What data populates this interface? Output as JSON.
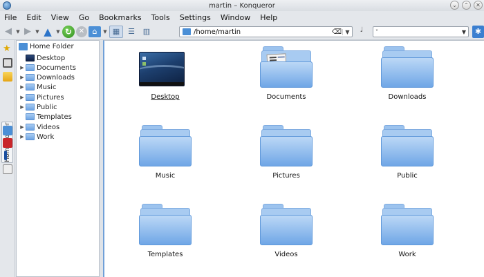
{
  "window": {
    "title": "martin – Konqueror"
  },
  "menu": [
    "File",
    "Edit",
    "View",
    "Go",
    "Bookmarks",
    "Tools",
    "Settings",
    "Window",
    "Help"
  ],
  "toolbar": {
    "location": "/home/martin",
    "search_value": ""
  },
  "sidebar_tab": "Home Folder",
  "tree": {
    "root": "Home Folder",
    "items": [
      "Desktop",
      "Documents",
      "Downloads",
      "Music",
      "Pictures",
      "Public",
      "Templates",
      "Videos",
      "Work"
    ]
  },
  "files": [
    {
      "name": "Desktop",
      "icon": "desktop-thumbnail"
    },
    {
      "name": "Documents",
      "icon": "folder-documents"
    },
    {
      "name": "Downloads",
      "icon": "folder"
    },
    {
      "name": "Music",
      "icon": "folder"
    },
    {
      "name": "Pictures",
      "icon": "folder"
    },
    {
      "name": "Public",
      "icon": "folder"
    },
    {
      "name": "Templates",
      "icon": "folder"
    },
    {
      "name": "Videos",
      "icon": "folder"
    },
    {
      "name": "Work",
      "icon": "folder"
    }
  ]
}
